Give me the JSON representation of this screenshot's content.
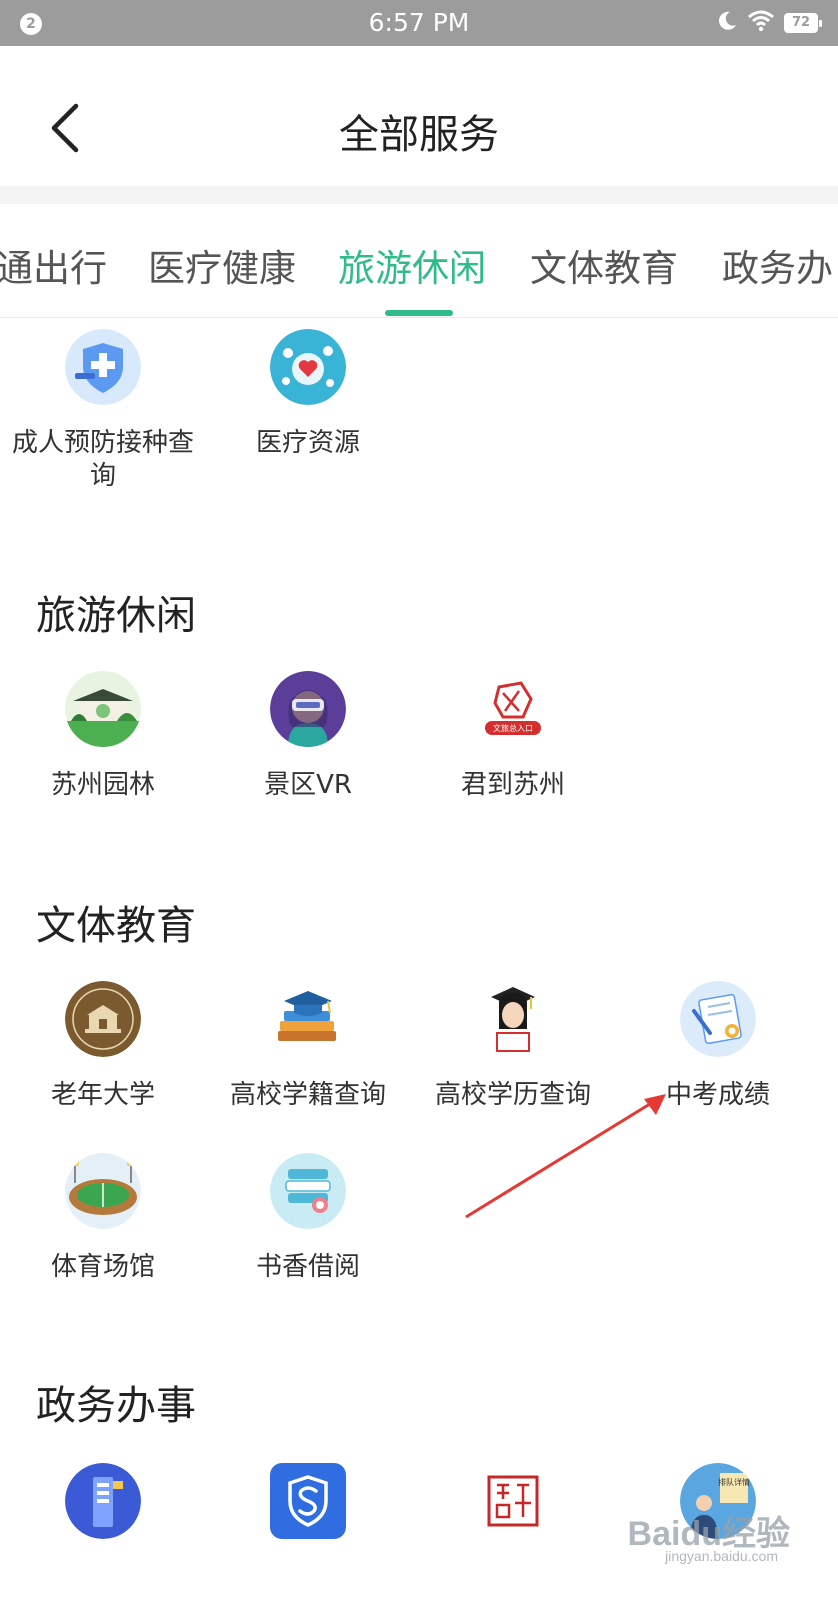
{
  "status_bar": {
    "notification_count": "2",
    "time": "6:57 PM",
    "battery": "72",
    "icons": [
      "moon-icon",
      "wifi-icon",
      "battery-icon"
    ]
  },
  "header": {
    "title": "全部服务",
    "back_icon": "chevron-left-icon"
  },
  "tabs": [
    {
      "label": "通出行",
      "active": false
    },
    {
      "label": "医疗健康",
      "active": false
    },
    {
      "label": "旅游休闲",
      "active": true
    },
    {
      "label": "文体教育",
      "active": false
    },
    {
      "label": "政务办",
      "active": false
    }
  ],
  "accent_color": "#2fbb8a",
  "sections": {
    "medical_partial": {
      "items": [
        {
          "label": "成人预防接种查询",
          "icon": "vaccine-shield-icon"
        },
        {
          "label": "医疗资源",
          "icon": "medical-resources-icon"
        }
      ]
    },
    "travel": {
      "title": "旅游休闲",
      "items": [
        {
          "label": "苏州园林",
          "icon": "garden-icon"
        },
        {
          "label": "景区VR",
          "icon": "vr-headset-icon"
        },
        {
          "label": "君到苏州",
          "icon": "culture-tourism-logo-icon",
          "icon_caption": "文旅总入口"
        }
      ]
    },
    "education": {
      "title": "文体教育",
      "items": [
        {
          "label": "老年大学",
          "icon": "senior-university-seal-icon"
        },
        {
          "label": "高校学籍查询",
          "icon": "graduation-books-icon"
        },
        {
          "label": "高校学历查询",
          "icon": "graduate-student-icon"
        },
        {
          "label": "中考成绩",
          "icon": "exam-certificate-icon"
        },
        {
          "label": "体育场馆",
          "icon": "stadium-icon"
        },
        {
          "label": "书香借阅",
          "icon": "book-borrow-icon"
        }
      ]
    },
    "government": {
      "title": "政务办事",
      "items": [
        {
          "icon": "gov-building-icon"
        },
        {
          "icon": "shield-s-icon"
        },
        {
          "icon": "seal-stamp-icon"
        },
        {
          "icon": "queue-detail-icon",
          "icon_caption": "排队详情"
        }
      ]
    }
  },
  "watermark": {
    "brand": "Baidu经验",
    "url": "jingyan.baidu.com"
  }
}
